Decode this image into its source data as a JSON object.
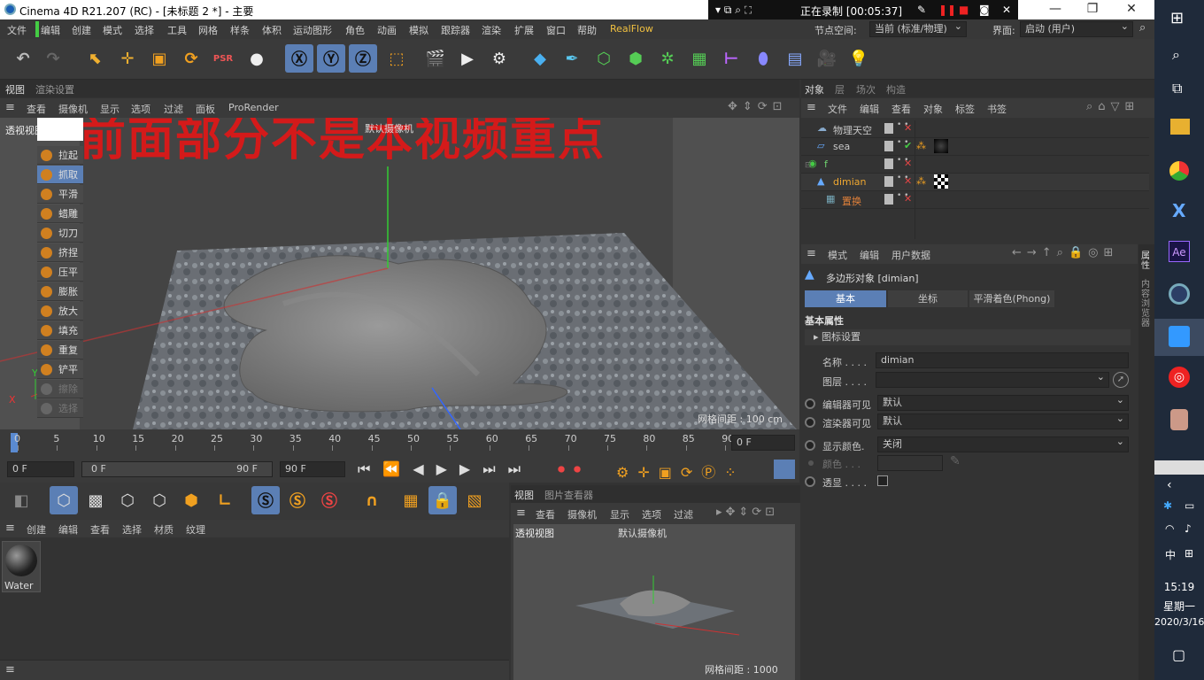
{
  "window": {
    "title": "Cinema 4D R21.207 (RC) - [未标题 2 *] - 主要"
  },
  "recorder": {
    "status": "正在录制 [00:05:37]"
  },
  "menu": [
    "文件",
    "编辑",
    "创建",
    "模式",
    "选择",
    "工具",
    "网格",
    "样条",
    "体积",
    "运动图形",
    "角色",
    "动画",
    "模拟",
    "跟踪器",
    "渲染",
    "扩展",
    "窗口",
    "帮助",
    "RealFlow"
  ],
  "node_space": {
    "label": "节点空间:",
    "value": "当前 (标准/物理)"
  },
  "interface": {
    "label": "界面:",
    "value": "启动 (用户)"
  },
  "viewport": {
    "tabs": [
      "视图",
      "渲染设置"
    ],
    "menu": [
      "查看",
      "摄像机",
      "显示",
      "选项",
      "过滤",
      "面板",
      "ProRender"
    ],
    "name": "透视视图",
    "camera": "默认摄像机",
    "overlay": "前面部分不是本视频重点",
    "grid": "网格间距 : 100 cm",
    "axis_x": "X",
    "axis_y": "Y"
  },
  "sculpt_tools": [
    "拉起",
    "抓取",
    "平滑",
    "蜡雕",
    "切刀",
    "挤捏",
    "压平",
    "膨胀",
    "放大",
    "填充",
    "重复",
    "铲平",
    "擦除",
    "选择"
  ],
  "timeline": {
    "ticks": [
      "0",
      "5",
      "10",
      "15",
      "20",
      "25",
      "30",
      "35",
      "40",
      "45",
      "50",
      "55",
      "60",
      "65",
      "70",
      "75",
      "80",
      "85",
      "90"
    ],
    "current": "0 F"
  },
  "transport": {
    "start": "0 F",
    "range_start": "0 F",
    "range_end": "90 F",
    "end": "90 F"
  },
  "material_manager": {
    "menu": [
      "创建",
      "编辑",
      "查看",
      "选择",
      "材质",
      "纹理"
    ],
    "materials": [
      {
        "name": "Water"
      }
    ]
  },
  "small_viewport": {
    "tabs": [
      "视图",
      "图片查看器"
    ],
    "menu": [
      "查看",
      "摄像机",
      "显示",
      "选项",
      "过滤"
    ],
    "name": "透视视图",
    "camera": "默认摄像机",
    "grid": "网格间距 : 1000 cm"
  },
  "object_manager": {
    "tabs": [
      "对象",
      "层",
      "场次",
      "构造"
    ],
    "menu": [
      "文件",
      "编辑",
      "查看",
      "对象",
      "标签",
      "书签"
    ],
    "objects": [
      {
        "name": "物理天空",
        "color": "#c8c8c8"
      },
      {
        "name": "sea",
        "color": "#c8c8c8"
      },
      {
        "name": "f",
        "color": "#6fd36f"
      },
      {
        "name": "dimian",
        "color": "#f0a830"
      },
      {
        "name": "置换",
        "color": "#e0803a"
      }
    ]
  },
  "attributes": {
    "menu": [
      "模式",
      "编辑",
      "用户数据"
    ],
    "object_title": "多边形对象 [dimian]",
    "tabs": [
      "基本",
      "坐标",
      "平滑着色(Phong)"
    ],
    "section": "基本属性",
    "icon_settings": "图标设置",
    "fields": {
      "name_label": "名称 . . . .",
      "name_value": "dimian",
      "layer_label": "图层 . . . .",
      "editor_visible_label": "编辑器可见",
      "editor_visible_value": "默认",
      "render_visible_label": "渲染器可见",
      "render_visible_value": "默认",
      "display_color_label": "显示颜色.",
      "display_color_value": "关闭",
      "color_label": "颜色 . . .",
      "xray_label": "透显 . . . ."
    },
    "side_tabs": [
      "属性",
      "内容浏览器"
    ]
  },
  "clock": {
    "time": "15:19",
    "day": "星期一",
    "date": "2020/3/16"
  },
  "ime": "中"
}
